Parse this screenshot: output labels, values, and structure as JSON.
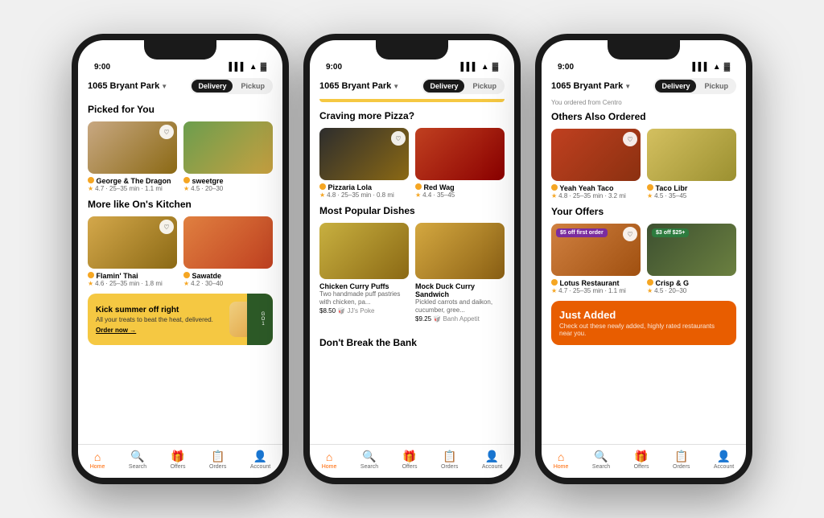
{
  "app": {
    "background": "#f0f0f0"
  },
  "phone1": {
    "status_time": "9:00",
    "location": "1065 Bryant Park",
    "delivery_label": "Delivery",
    "pickup_label": "Pickup",
    "section1_title": "Picked for You",
    "card1_name": "George & The Dragon",
    "card1_rating": "4.7",
    "card1_time": "25–35 min",
    "card1_dist": "1.1 mi",
    "card2_name": "sweetgre",
    "card2_rating": "4.5",
    "card2_time": "20–30",
    "section2_title": "More like On's Kitchen",
    "card3_name": "Flamin' Thai",
    "card3_rating": "4.6",
    "card3_time": "25–35 min",
    "card3_dist": "1.8 mi",
    "card4_name": "Sawatde",
    "card4_rating": "4.2",
    "card4_time": "30–40",
    "promo_title": "Kick summer off right",
    "promo_sub": "All your treats to beat the heat, delivered.",
    "promo_link": "Order now →",
    "nav_home": "Home",
    "nav_search": "Search",
    "nav_offers": "Offers",
    "nav_orders": "Orders",
    "nav_account": "Account"
  },
  "phone2": {
    "status_time": "9:00",
    "location": "1065 Bryant Park",
    "delivery_label": "Delivery",
    "pickup_label": "Pickup",
    "section1_title": "Craving more Pizza?",
    "card1_name": "Pizzaria Lola",
    "card1_rating": "4.8",
    "card1_time": "25–35 min",
    "card1_dist": "0.8 mi",
    "card2_name": "Red Wag",
    "card2_rating": "4.4",
    "card2_time": "35–45",
    "section2_title": "Most Popular Dishes",
    "dish1_name": "Chicken Curry Puffs",
    "dish1_desc": "Two handmade puff pastries with chicken, pa...",
    "dish1_price": "$8.50",
    "dish1_source": "🥡 JJ's Poke",
    "dish2_name": "Mock Duck Curry Sandwich",
    "dish2_desc": "Pickled carrots and daikon, cucumber, gree...",
    "dish2_price": "$9.25",
    "dish2_source": "🥡 Banh Appetit",
    "section3_title": "Don't Break the Bank",
    "nav_home": "Home",
    "nav_search": "Search",
    "nav_offers": "Offers",
    "nav_orders": "Orders",
    "nav_account": "Account"
  },
  "phone3": {
    "status_time": "9:00",
    "location": "1065 Bryant Park",
    "delivery_label": "Delivery",
    "pickup_label": "Pickup",
    "ordered_from": "You ordered from Centro",
    "section1_title": "Others Also Ordered",
    "card1_name": "Yeah Yeah Taco",
    "card1_rating": "4.8",
    "card1_time": "25–35 min",
    "card1_dist": "3.2 mi",
    "card2_name": "Taco Libr",
    "card2_rating": "4.5",
    "card2_time": "35–45",
    "section2_title": "Your Offers",
    "offer1_name": "Lotus Restaurant",
    "offer1_rating": "4.7",
    "offer1_time": "25–35 min",
    "offer1_dist": "1.1 mi",
    "offer1_badge": "$5 off first order",
    "offer2_name": "Crisp & G",
    "offer2_rating": "4.5",
    "offer2_time": "20–30",
    "offer2_badge": "$3 off $25+",
    "just_added_title": "Just Added",
    "just_added_sub": "Check out these newly added, highly rated restaurants near you.",
    "nav_home": "Home",
    "nav_search": "Search",
    "nav_offers": "Offers",
    "nav_orders": "Orders",
    "nav_account": "Account"
  }
}
